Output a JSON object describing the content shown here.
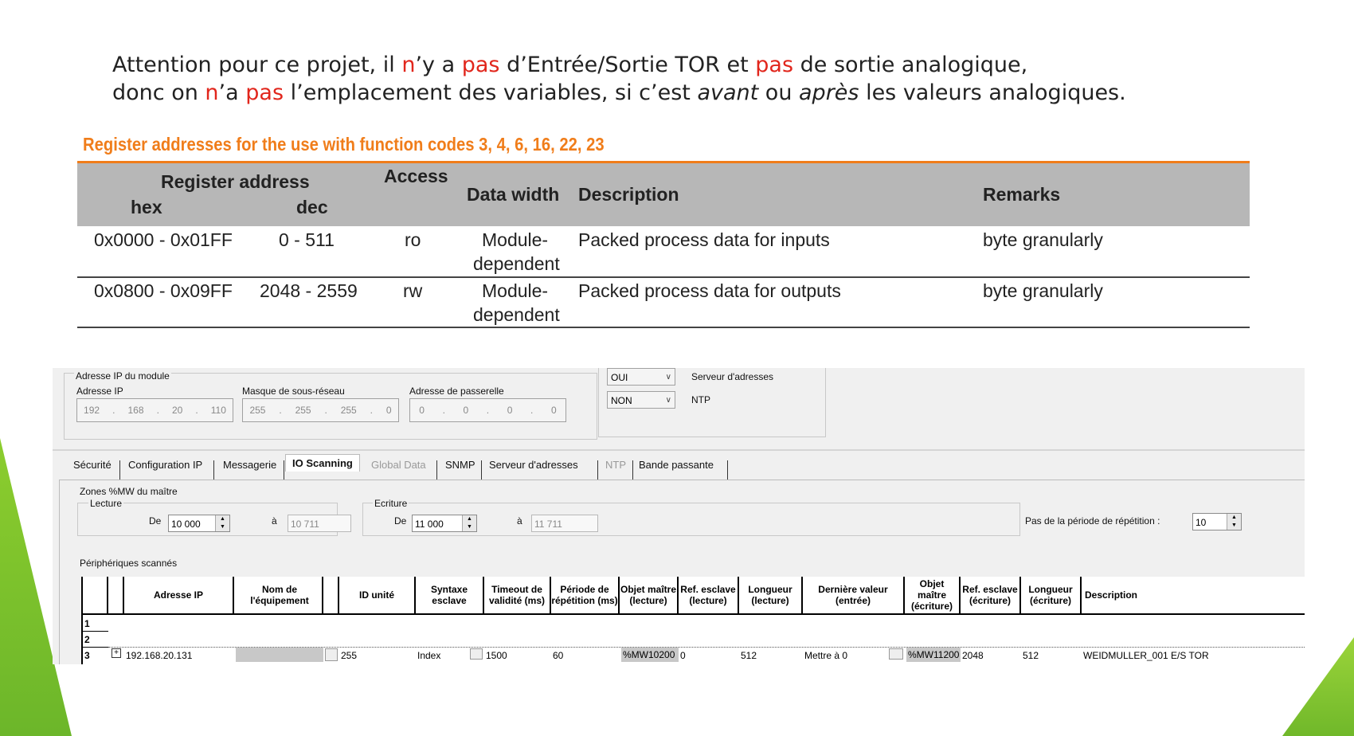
{
  "notice": {
    "l1_a": "Attention pour ce projet, il ",
    "l1_n": "n",
    "l1_b": "’y a ",
    "l1_pas": "pas",
    "l1_c": " d’Entrée/Sortie TOR et ",
    "l1_pas2": "pas",
    "l1_d": " de sortie analogique,",
    "l2_a": "donc on ",
    "l2_n": "n",
    "l2_b": "’a ",
    "l2_pas": "pas",
    "l2_c": " l’emplacement des variables, si c’est ",
    "l2_avant": "avant",
    "l2_d": " ou ",
    "l2_apres": "après",
    "l2_e": " les valeurs analogiques."
  },
  "register": {
    "title": "Register addresses for the use with function codes 3, 4, 6, 16, 22, 23",
    "headers": {
      "register_address": "Register address",
      "hex": "hex",
      "dec": "dec",
      "access": "Access",
      "data_width": "Data width",
      "description": "Description",
      "remarks": "Remarks"
    },
    "rows": [
      {
        "hex": "0x0000 - 0x01FF",
        "dec": "0 - 511",
        "access": "ro",
        "width1": "Module-",
        "width2": "dependent",
        "description": "Packed process data for inputs",
        "remarks": "byte granularly"
      },
      {
        "hex": "0x0800 - 0x09FF",
        "dec": "2048 - 2559",
        "access": "rw",
        "width1": "Module-",
        "width2": "dependent",
        "description": "Packed process data for outputs",
        "remarks": "byte granularly"
      }
    ]
  },
  "module": {
    "group_label": "Adresse IP du module",
    "ip_label": "Adresse IP",
    "ip": [
      "192",
      "168",
      "20",
      "110"
    ],
    "mask_label": "Masque de sous-réseau",
    "mask": [
      "255",
      "255",
      "255",
      "0"
    ],
    "gateway_label": "Adresse de passerelle",
    "gateway": [
      "0",
      "0",
      "0",
      "0"
    ],
    "server_combo": "OUI",
    "server_label": "Serveur d'adresses",
    "ntp_combo": "NON",
    "ntp_label": "NTP"
  },
  "tabs": [
    "Sécurité",
    "Configuration IP",
    "Messagerie",
    "IO Scanning",
    "Global Data",
    "SNMP",
    "Serveur d'adresses",
    "NTP",
    "Bande passante"
  ],
  "scanning": {
    "zones_label": "Zones %MW du maître",
    "lecture_label": "Lecture",
    "ecriture_label": "Ecriture",
    "de_label": "De",
    "a_label": "à",
    "lecture_from": "10 000",
    "lecture_to": "10 711",
    "ecriture_from": "11 000",
    "ecriture_to": "11 711",
    "period_label": "Pas de la période de répétition :",
    "period_value": "10",
    "devices_label": "Périphériques scannés"
  },
  "grid": {
    "headers": [
      "Adresse IP",
      "Nom de l'équipement",
      "ID unité",
      "Syntaxe esclave",
      "Timeout de validité (ms)",
      "Période de répétition (ms)",
      "Objet maître (lecture)",
      "Ref. esclave (lecture)",
      "Longueur (lecture)",
      "Dernière valeur (entrée)",
      "Objet maître (écriture)",
      "Ref. esclave (écriture)",
      "Longueur (écriture)",
      "Description"
    ],
    "row_numbers": [
      "1",
      "2",
      "3"
    ],
    "row3": {
      "expand": "+",
      "ip": "192.168.20.131",
      "name": "",
      "unit_id": "255",
      "syntax": "Index",
      "timeout": "1500",
      "period": "60",
      "obj_read": "%MW10200",
      "ref_read": "0",
      "len_read": "512",
      "last_value": "Mettre à 0",
      "obj_write": "%MW11200",
      "ref_write": "2048",
      "len_write": "512",
      "description": "WEIDMULLER_001 E/S TOR"
    }
  }
}
